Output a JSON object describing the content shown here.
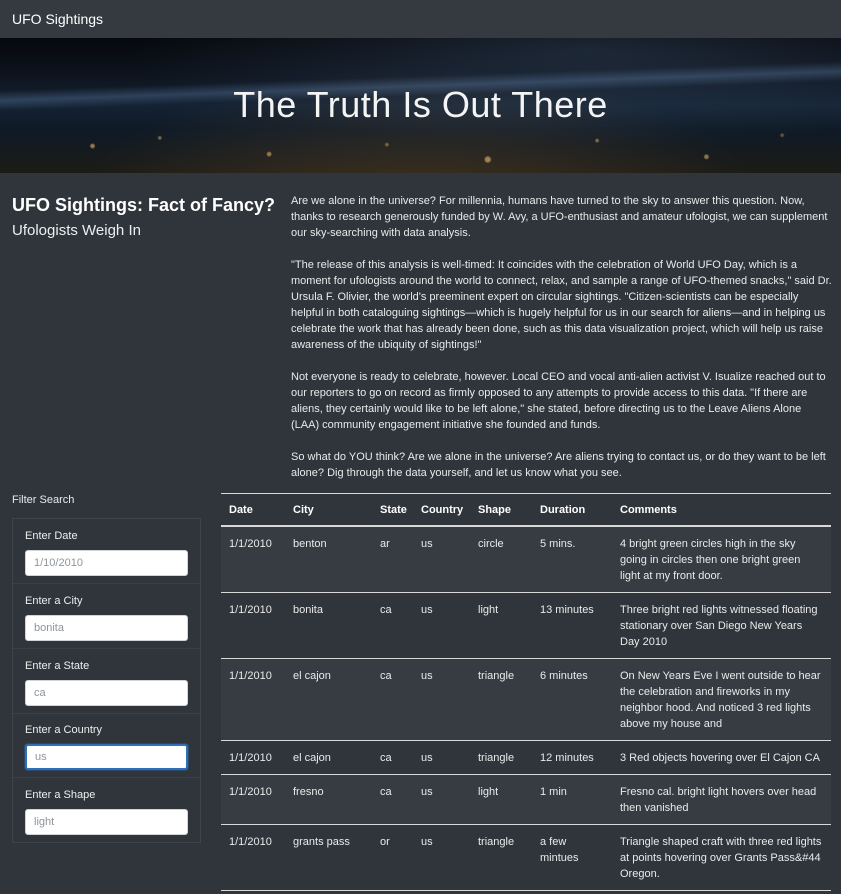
{
  "navbar": {
    "brand": "UFO Sightings"
  },
  "hero": {
    "title": "The Truth Is Out There"
  },
  "heading": {
    "title": "UFO Sightings: Fact of Fancy?",
    "subtitle": "Ufologists Weigh In"
  },
  "article": {
    "paragraphs": [
      "Are we alone in the universe? For millennia, humans have turned to the sky to answer this question. Now, thanks to research generously funded by W. Avy, a UFO-enthusiast and amateur ufologist, we can supplement our sky-searching with data analysis.",
      "\"The release of this analysis is well-timed: It coincides with the celebration of World UFO Day, which is a moment for ufologists around the world to connect, relax, and sample a range of UFO-themed snacks,\" said Dr. Ursula F. Olivier, the world's preeminent expert on circular sightings. \"Citizen-scientists can be especially helpful in both cataloguing sightings—which is hugely helpful for us in our search for aliens—and in helping us celebrate the work that has already been done, such as this data visualization project, which will help us raise awareness of the ubiquity of sightings!\"",
      "Not everyone is ready to celebrate, however. Local CEO and vocal anti-alien activist V. Isualize reached out to our reporters to go on record as firmly opposed to any attempts to provide access to this data. \"If there are aliens, they certainly would like to be left alone,\" she stated, before directing us to the Leave Aliens Alone (LAA) community engagement initiative she founded and funds.",
      "So what do YOU think? Are we alone in the universe? Are aliens trying to contact us, or do they want to be left alone? Dig through the data yourself, and let us know what you see."
    ]
  },
  "filters": {
    "title": "Filter Search",
    "date": {
      "label": "Enter Date",
      "placeholder": "1/10/2010",
      "value": ""
    },
    "city": {
      "label": "Enter a City",
      "placeholder": "bonita",
      "value": ""
    },
    "state": {
      "label": "Enter a State",
      "placeholder": "ca",
      "value": ""
    },
    "country": {
      "label": "Enter a Country",
      "placeholder": "us",
      "value": ""
    },
    "shape": {
      "label": "Enter a Shape",
      "placeholder": "light",
      "value": ""
    }
  },
  "table": {
    "headers": {
      "date": "Date",
      "city": "City",
      "state": "State",
      "country": "Country",
      "shape": "Shape",
      "duration": "Duration",
      "comments": "Comments"
    },
    "rows": [
      {
        "date": "1/1/2010",
        "city": "benton",
        "state": "ar",
        "country": "us",
        "shape": "circle",
        "duration": "5 mins.",
        "comments": "4 bright green circles high in the sky going in circles then one bright green light at my front door."
      },
      {
        "date": "1/1/2010",
        "city": "bonita",
        "state": "ca",
        "country": "us",
        "shape": "light",
        "duration": "13 minutes",
        "comments": "Three bright red lights witnessed floating stationary over San Diego New Years Day 2010"
      },
      {
        "date": "1/1/2010",
        "city": "el cajon",
        "state": "ca",
        "country": "us",
        "shape": "triangle",
        "duration": "6 minutes",
        "comments": "On New Years Eve I went outside to hear the celebration and fireworks in my neighbor hood. And noticed 3 red lights above my house and"
      },
      {
        "date": "1/1/2010",
        "city": "el cajon",
        "state": "ca",
        "country": "us",
        "shape": "triangle",
        "duration": "12 minutes",
        "comments": "3 Red objects hovering over El Cajon CA"
      },
      {
        "date": "1/1/2010",
        "city": "fresno",
        "state": "ca",
        "country": "us",
        "shape": "light",
        "duration": "1 min",
        "comments": "Fresno cal. bright light hovers over head then vanished"
      },
      {
        "date": "1/1/2010",
        "city": "grants pass",
        "state": "or",
        "country": "us",
        "shape": "triangle",
        "duration": "a few mintues",
        "comments": "Triangle shaped craft with three red lights at points hovering over Grants Pass&#44 Oregon."
      }
    ]
  }
}
